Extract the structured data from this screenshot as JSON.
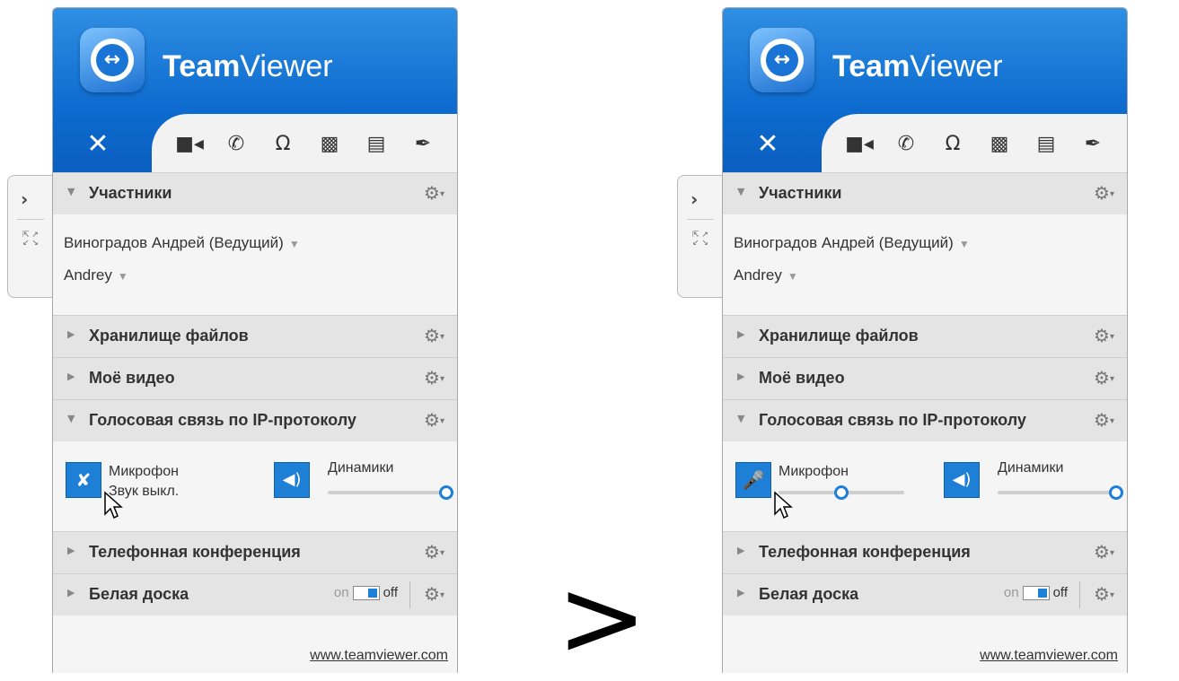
{
  "compare_symbol": ">",
  "panels": [
    {
      "id": "left",
      "brand_bold": "Team",
      "brand_light": "Viewer",
      "sections": {
        "participants": "Участники",
        "files": "Хранилище файлов",
        "video": "Моё видео",
        "voip": "Голосовая связь по IP-протоколу",
        "phone": "Телефонная конференция",
        "whiteboard": "Белая доска"
      },
      "participants": [
        "Виноградов Андрей (Ведущий)",
        "Andrey"
      ],
      "mic_label": "Микрофон",
      "mic_status": "Звук выкл.",
      "speakers_label": "Динамики",
      "toggle_on": "on",
      "toggle_off": "off",
      "footer_link": "www.teamviewer.com"
    },
    {
      "id": "right",
      "brand_bold": "Team",
      "brand_light": "Viewer",
      "sections": {
        "participants": "Участники",
        "files": "Хранилище файлов",
        "video": "Моё видео",
        "voip": "Голосовая связь по IP-протоколу",
        "phone": "Телефонная конференция",
        "whiteboard": "Белая доска"
      },
      "participants": [
        "Виноградов Андрей (Ведущий)",
        "Andrey"
      ],
      "mic_label": "Микрофон",
      "mic_status": "",
      "speakers_label": "Динамики",
      "toggle_on": "on",
      "toggle_off": "off",
      "footer_link": "www.teamviewer.com"
    }
  ],
  "icons": [
    "close-icon",
    "video-camera-icon",
    "phone-icon",
    "headset-icon",
    "chat-icon",
    "file-icon",
    "brush-icon",
    "more-icon",
    "gear-icon",
    "microphone-muted-icon",
    "microphone-icon",
    "speaker-icon",
    "expand-arrow-icon",
    "fullscreen-icon"
  ],
  "colors": {
    "brand_blue": "#1a74d6",
    "accent": "#1e7fd6"
  }
}
